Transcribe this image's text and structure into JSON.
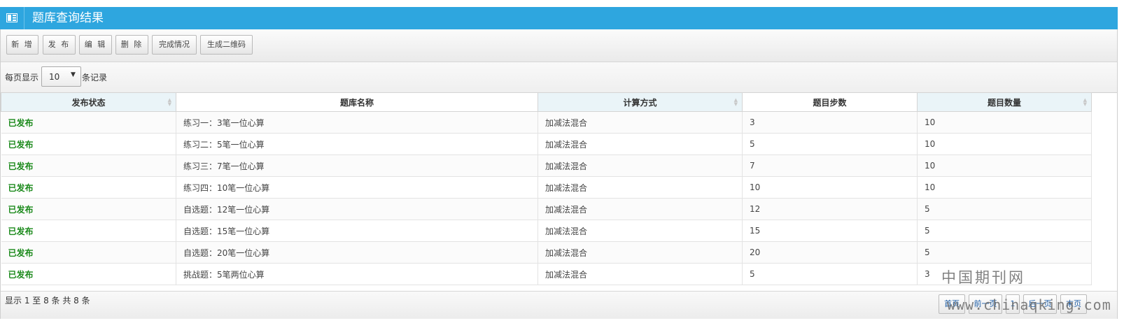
{
  "header": {
    "title": "题库查询结果"
  },
  "toolbar": {
    "buttons": [
      "新 增",
      "发 布",
      "编 辑",
      "删 除",
      "完成情况",
      "生成二维码"
    ]
  },
  "length_menu": {
    "prefix": "每页显示",
    "selected": "10",
    "suffix": "条记录"
  },
  "table": {
    "columns": [
      "发布状态",
      "题库名称",
      "计算方式",
      "题目步数",
      "题目数量"
    ],
    "rows": [
      [
        "已发布",
        "练习一：3笔一位心算",
        "加减法混合",
        "3",
        "10"
      ],
      [
        "已发布",
        "练习二：5笔一位心算",
        "加减法混合",
        "5",
        "10"
      ],
      [
        "已发布",
        "练习三：7笔一位心算",
        "加减法混合",
        "7",
        "10"
      ],
      [
        "已发布",
        "练习四：10笔一位心算",
        "加减法混合",
        "10",
        "10"
      ],
      [
        "已发布",
        "自选题：12笔一位心算",
        "加减法混合",
        "12",
        "5"
      ],
      [
        "已发布",
        "自选题：15笔一位心算",
        "加减法混合",
        "15",
        "5"
      ],
      [
        "已发布",
        "自选题：20笔一位心算",
        "加减法混合",
        "20",
        "5"
      ],
      [
        "已发布",
        "挑战题：5笔两位心算",
        "加减法混合",
        "5",
        "3"
      ]
    ]
  },
  "footer": {
    "info": "显示 1 至 8 条  共 8 条",
    "pagination": [
      "首页",
      "前一页",
      "1",
      "后一页",
      "末页"
    ]
  },
  "watermark": {
    "line1": "中国期刊网",
    "line2": "www.chinaqking.com"
  },
  "colors": {
    "header_bg": "#2ea6df",
    "status_text": "#1c8a1c"
  }
}
